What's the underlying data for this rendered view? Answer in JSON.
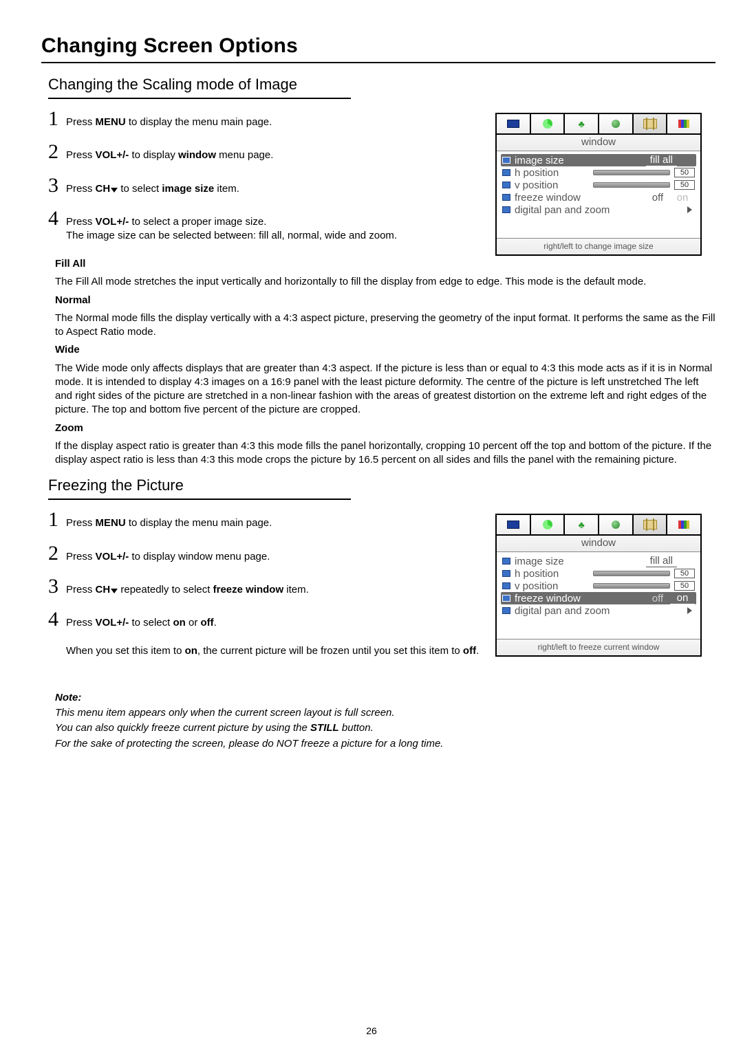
{
  "page_title": "Changing Screen Options",
  "page_number": "26",
  "section_a": {
    "heading": "Changing the Scaling mode of Image",
    "steps": {
      "s1_pre": "Press ",
      "s1_bold": "MENU",
      "s1_post": " to display the menu main page.",
      "s2_pre": "Press ",
      "s2_bold1": "VOL+/-",
      "s2_mid": " to display ",
      "s2_bold2": "window",
      "s2_post": " menu page.",
      "s3_pre": "Press ",
      "s3_bold1": "CH",
      "s3_mid": " to select ",
      "s3_bold2": "image size",
      "s3_post": " item.",
      "s4_pre": "Press ",
      "s4_bold": "VOL+/-",
      "s4_post": " to select a proper image size.",
      "s4_line2": "The image size can be selected between: fill all, normal, wide and zoom."
    },
    "modes": {
      "fillall_h": "Fill All",
      "fillall_t": "The Fill All mode stretches the input vertically and horizontally to fill the display from edge to edge. This mode is the default mode.",
      "normal_h": "Normal",
      "normal_t": "The Normal mode fills the display vertically with a 4:3 aspect picture, preserving the geometry of the input format. It performs the same as the Fill to Aspect Ratio mode.",
      "wide_h": "Wide",
      "wide_t": "The Wide mode only affects displays that are greater than 4:3 aspect. If the picture is less than or equal to 4:3 this mode acts as if it is in Normal mode. It is intended to display 4:3 images on a 16:9 panel with the least picture deformity. The centre of the picture is left unstretched The left and right sides of the picture are stretched in a non-linear fashion with the areas of greatest distortion on the extreme left and right edges of the picture. The top and bottom five percent of the picture are cropped.",
      "zoom_h": "Zoom",
      "zoom_t": "If the display aspect ratio is greater than 4:3 this mode fills the panel horizontally, cropping 10 percent off the top and bottom of the picture. If the display aspect ratio is less than 4:3 this mode crops the picture by 16.5 percent on all sides and fills the panel with the remaining picture."
    }
  },
  "section_b": {
    "heading": "Freezing the Picture",
    "steps": {
      "s1_pre": "Press ",
      "s1_bold": "MENU",
      "s1_post": " to display the menu main page.",
      "s2_pre": "Press ",
      "s2_bold": "VOL+/-",
      "s2_post": " to display window menu page.",
      "s3_pre": "Press ",
      "s3_bold1": "CH",
      "s3_mid": " repeatedly to select ",
      "s3_bold2": "freeze window",
      "s3_post": " item.",
      "s4_pre": "Press ",
      "s4_bold1": "VOL+/-",
      "s4_mid": " to select ",
      "s4_bold2": "on",
      "s4_mid2": " or ",
      "s4_bold3": "off",
      "s4_post": ".",
      "s4_line2a": "When you set this item to ",
      "s4_line2_on": "on",
      "s4_line2b": ", the current picture will be frozen until you set this item to ",
      "s4_line2_off": "off",
      "s4_line2c": "."
    }
  },
  "note": {
    "label": "Note:",
    "l1": "This menu item appears only when the current screen layout is full screen.",
    "l2a": "You can also quickly freeze current picture by using the ",
    "l2_bold": "STILL",
    "l2b": " button.",
    "l3": "For the sake of protecting the screen, please do NOT freeze a picture for a long time."
  },
  "osd": {
    "title": "window",
    "rows": {
      "image_size": "image size",
      "image_size_val": "fill all",
      "h_position": "h position",
      "h_val": "50",
      "v_position": "v position",
      "v_val": "50",
      "freeze": "freeze window",
      "off": "off",
      "on": "on",
      "dpz": "digital pan and zoom"
    },
    "footer_a": "right/left to change image size",
    "footer_b": "right/left to freeze current window"
  }
}
